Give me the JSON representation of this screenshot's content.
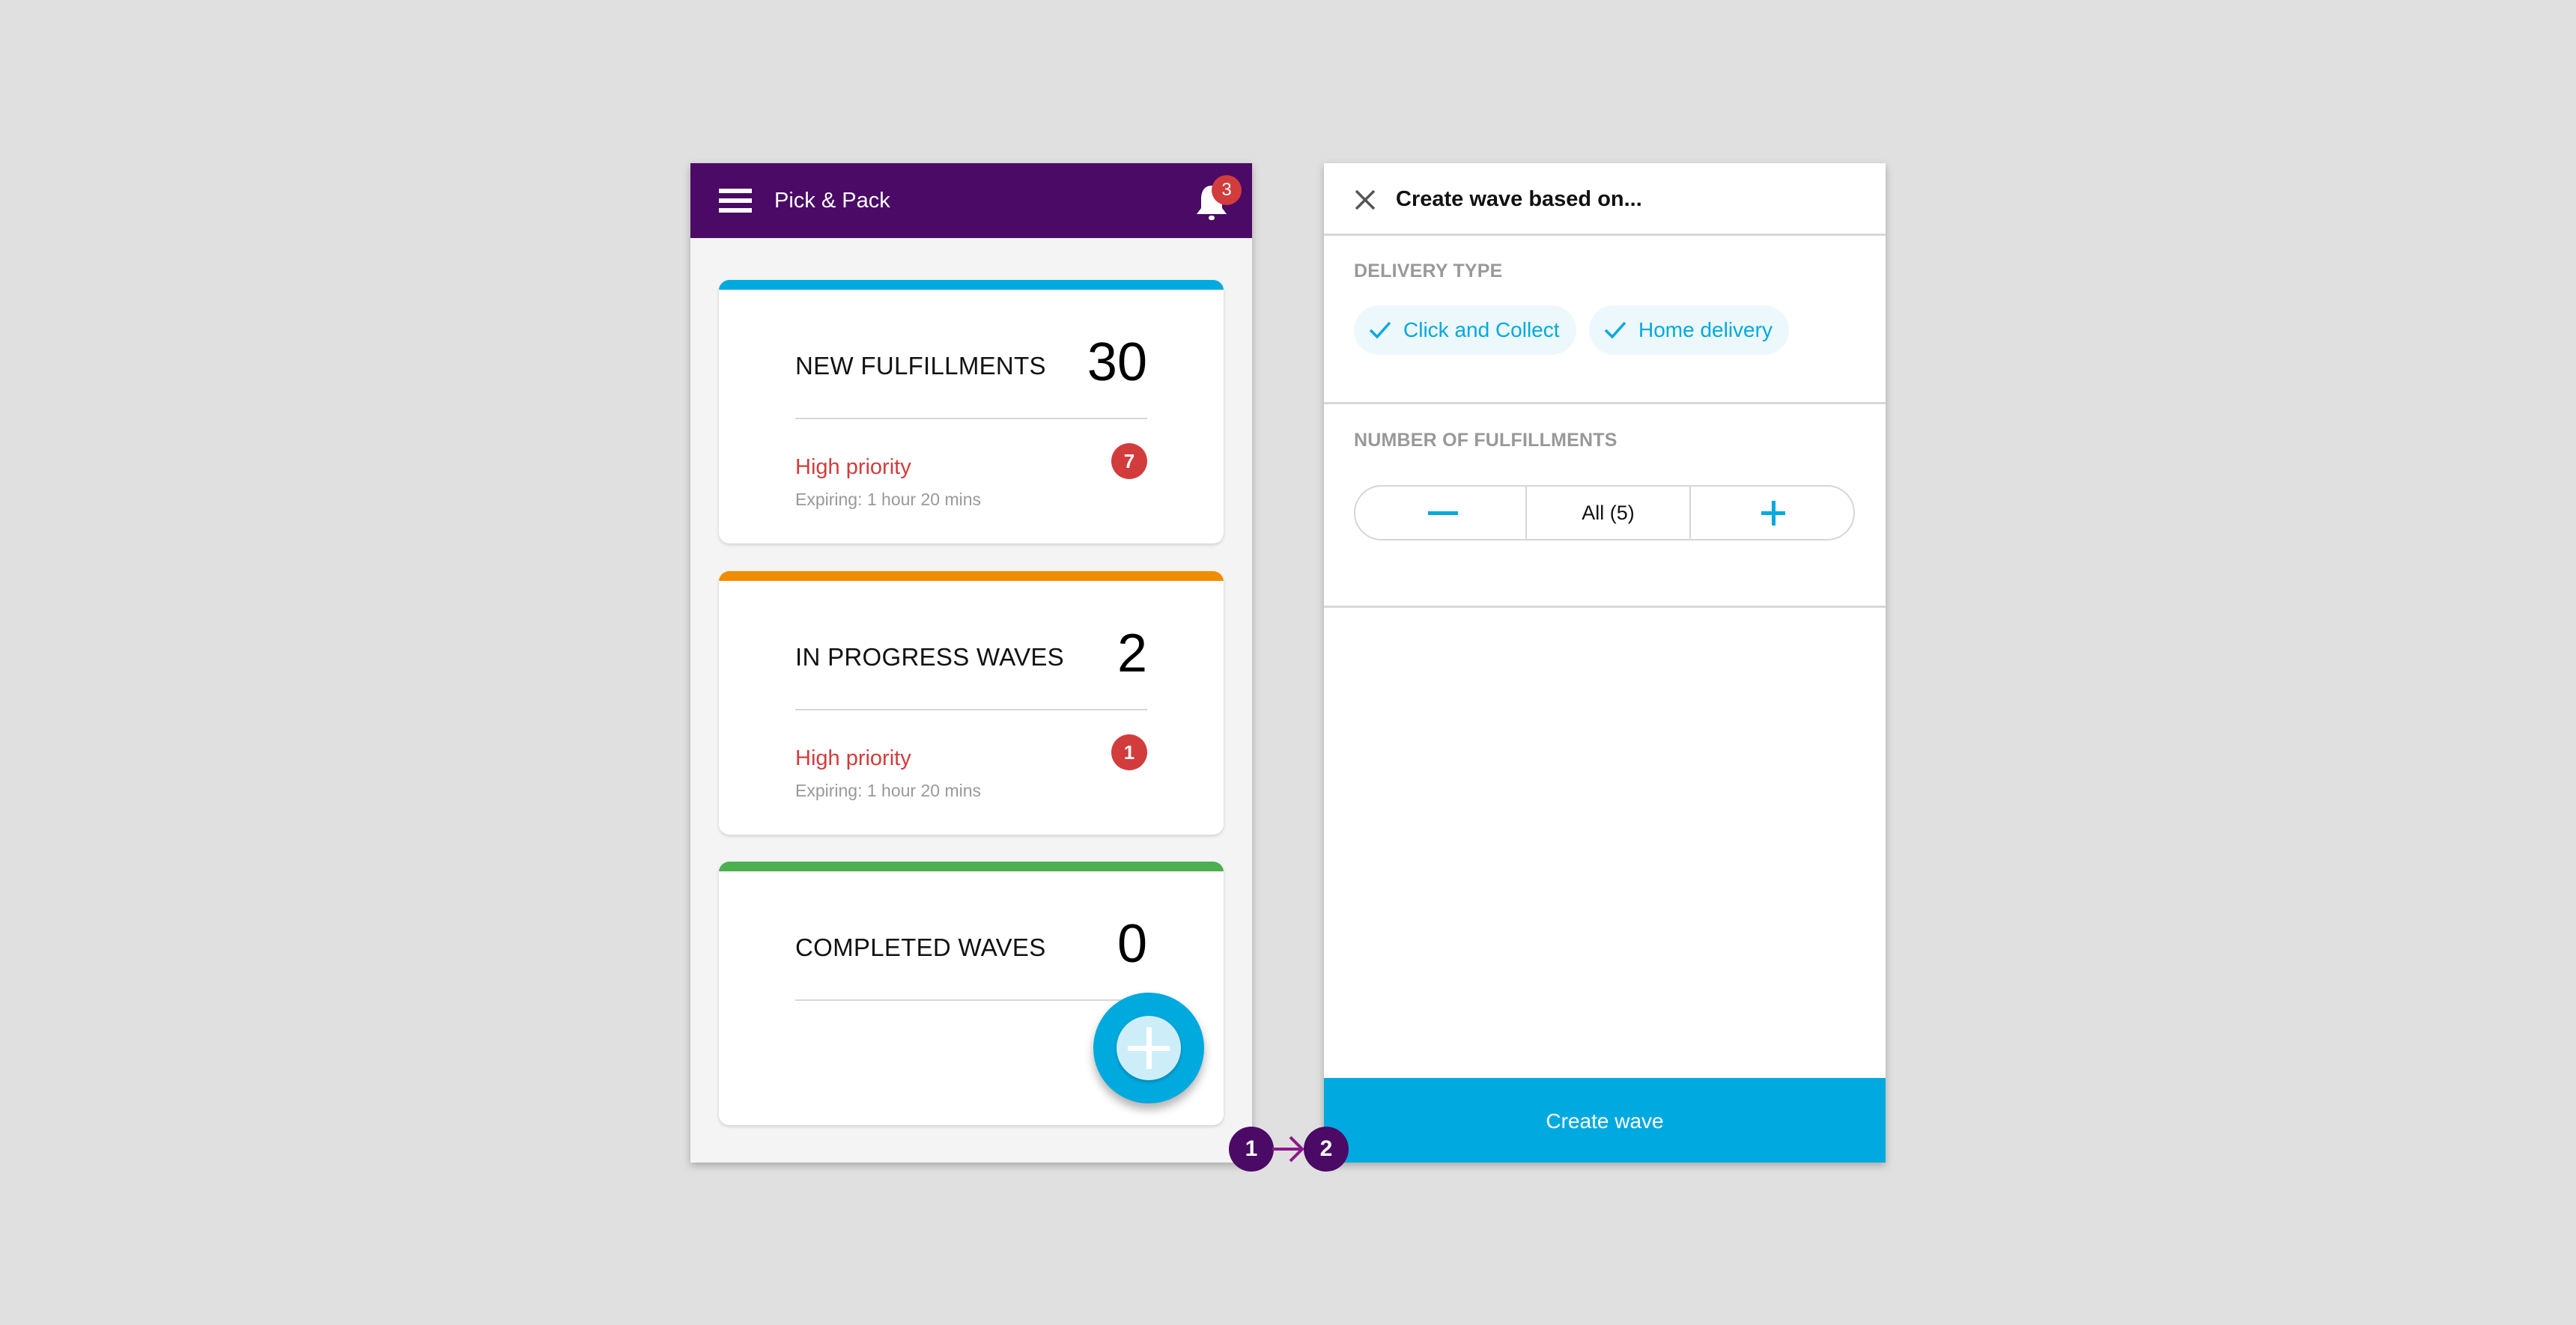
{
  "colors": {
    "background": "#e0e0e0",
    "brand_purple": "#4a0a66",
    "accent_blue": "#00a9de",
    "danger_red": "#d23c3c",
    "card_new": "#00a9de",
    "card_in_progress": "#f08c00",
    "card_completed": "#4caf50",
    "step_arrow": "#8b1a8b"
  },
  "left_screen": {
    "header": {
      "menu_icon": "hamburger-icon",
      "title": "Pick & Pack",
      "notification_icon": "bell-icon",
      "notification_count": "3"
    },
    "cards": [
      {
        "title": "NEW FULFILLMENTS",
        "count": "30",
        "accent": "blue",
        "priority_label": "High priority",
        "priority_count": "7",
        "expiring": "Expiring: 1 hour 20 mins"
      },
      {
        "title": "IN PROGRESS WAVES",
        "count": "2",
        "accent": "orange",
        "priority_label": "High priority",
        "priority_count": "1",
        "expiring": "Expiring: 1 hour 20 mins"
      },
      {
        "title": "COMPLETED WAVES",
        "count": "0",
        "accent": "green"
      }
    ],
    "fab_icon": "plus-icon"
  },
  "right_screen": {
    "close_icon": "close-icon",
    "title": "Create wave based on...",
    "delivery_type": {
      "label": "DELIVERY TYPE",
      "options": [
        {
          "label": "Click and Collect",
          "selected": true
        },
        {
          "label": "Home delivery",
          "selected": true
        }
      ]
    },
    "fulfillments": {
      "label": "NUMBER OF FULFILLMENTS",
      "value": "All (5)",
      "decrement_icon": "minus-icon",
      "increment_icon": "plus-icon"
    },
    "create_button": "Create wave"
  },
  "flow": {
    "steps": [
      "1",
      "2"
    ],
    "arrow_icon": "arrow-right-icon"
  }
}
